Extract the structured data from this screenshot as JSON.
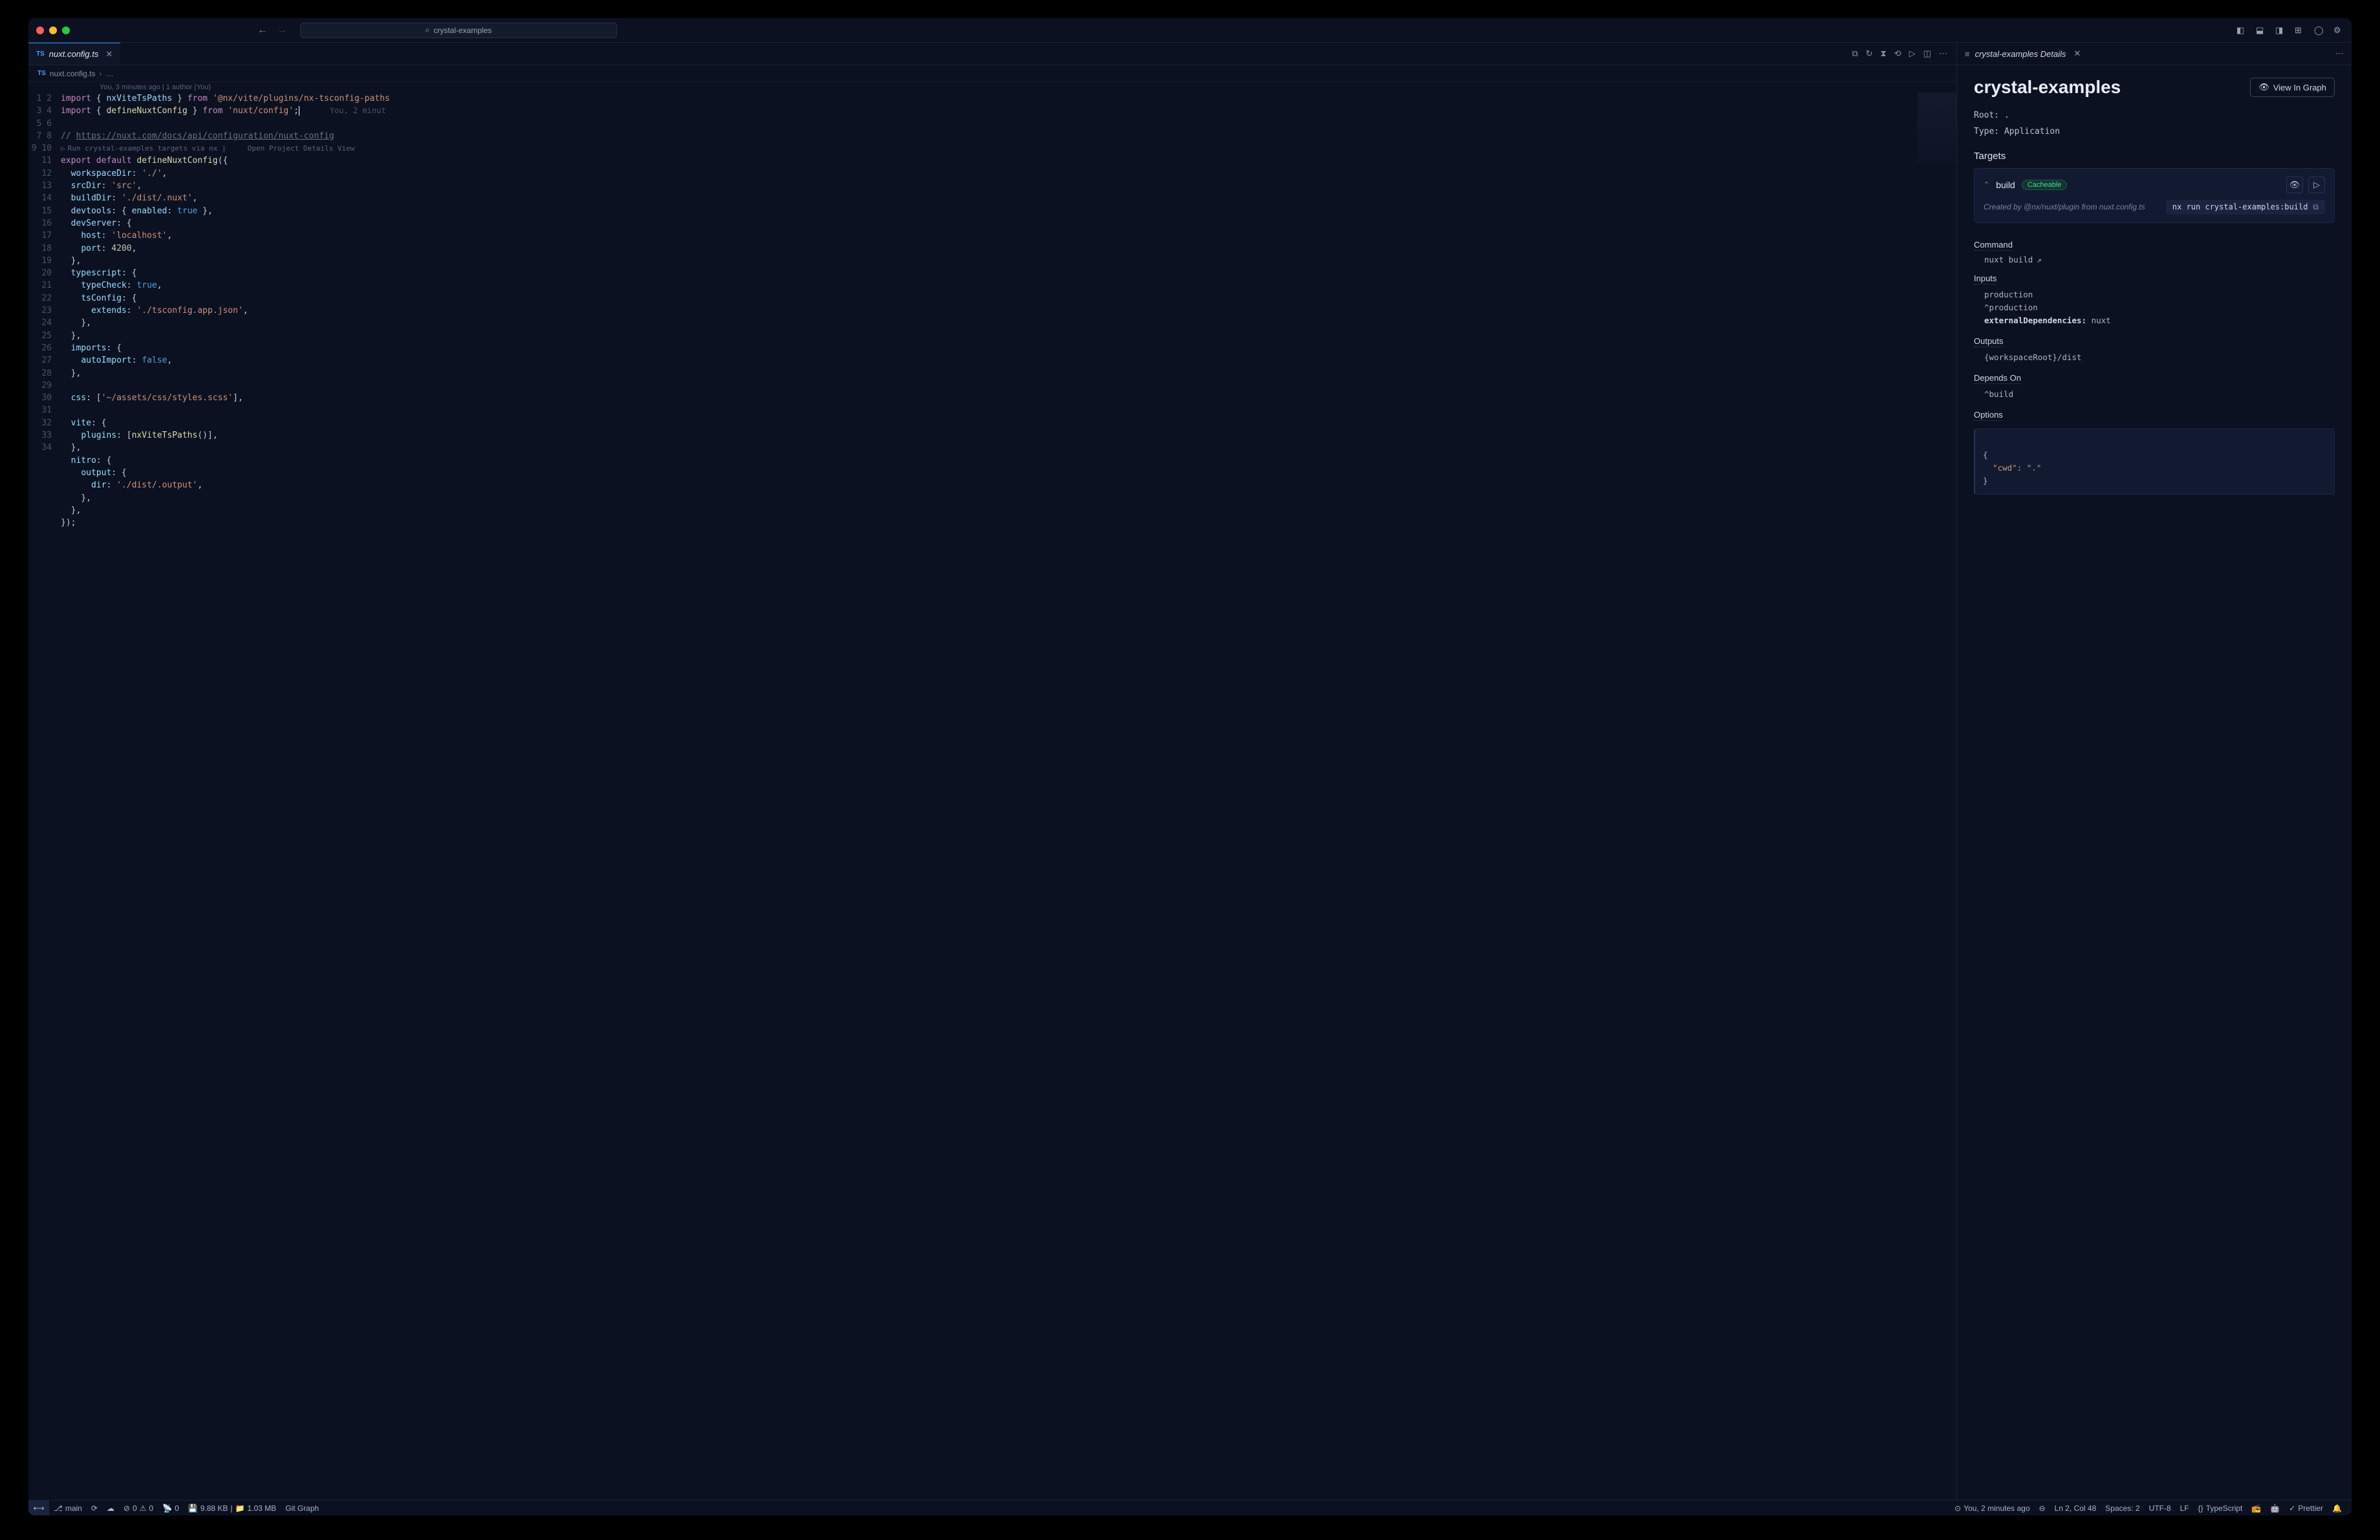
{
  "titlebar": {
    "search": "crystal-examples"
  },
  "editor": {
    "tab": {
      "filename": "nuxt.config.ts"
    },
    "breadcrumb": {
      "file": "nuxt.config.ts",
      "more": "…"
    },
    "blame": "You, 3 minutes ago | 1 author (You)",
    "inline_blame": "You, 2 minut",
    "codelens": "Run crystal-examples targets via nx |     Open Project Details View",
    "lines": [
      "import { nxViteTsPaths } from '@nx/vite/plugins/nx-tsconfig-paths",
      "import { defineNuxtConfig } from 'nuxt/config';",
      "",
      "// https://nuxt.com/docs/api/configuration/nuxt-config",
      "export default defineNuxtConfig({",
      "  workspaceDir: './',",
      "  srcDir: 'src',",
      "  buildDir: './dist/.nuxt',",
      "  devtools: { enabled: true },",
      "  devServer: {",
      "    host: 'localhost',",
      "    port: 4200,",
      "  },",
      "  typescript: {",
      "    typeCheck: true,",
      "    tsConfig: {",
      "      extends: './tsconfig.app.json',",
      "    },",
      "  },",
      "  imports: {",
      "    autoImport: false,",
      "  },",
      "",
      "  css: ['~/assets/css/styles.scss'],",
      "",
      "  vite: {",
      "    plugins: [nxViteTsPaths()],",
      "  },",
      "  nitro: {",
      "    output: {",
      "      dir: './dist/.output',",
      "    },",
      "  },",
      "});"
    ]
  },
  "details": {
    "tab_label": "crystal-examples Details",
    "title": "crystal-examples",
    "view_graph": "View In Graph",
    "root_label": "Root:",
    "root_val": ".",
    "type_label": "Type:",
    "type_val": "Application",
    "targets_h": "Targets",
    "target": {
      "name": "build",
      "cache": "Cacheable",
      "created_by": "Created by @nx/nuxt/plugin from nuxt.config.ts",
      "run_cmd": "nx run crystal-examples:build"
    },
    "command_h": "Command",
    "command_val": "nuxt build",
    "inputs_h": "Inputs",
    "inputs": [
      "production",
      "^production"
    ],
    "inputs_ext_key": "externalDependencies:",
    "inputs_ext_val": "nuxt",
    "outputs_h": "Outputs",
    "outputs_val": "{workspaceRoot}/dist",
    "depends_h": "Depends On",
    "depends_val": "^build",
    "options_h": "Options",
    "options_json": {
      "cwd": "."
    }
  },
  "statusbar": {
    "branch": "main",
    "errors": "0",
    "warnings": "0",
    "ports": "0",
    "size1": "9.88 KB",
    "size2": "1.03 MB",
    "git_graph": "Git Graph",
    "blame": "You, 2 minutes ago",
    "cursor": "Ln 2, Col 48",
    "spaces": "Spaces: 2",
    "encoding": "UTF-8",
    "eol": "LF",
    "lang": "TypeScript",
    "prettier": "Prettier"
  }
}
